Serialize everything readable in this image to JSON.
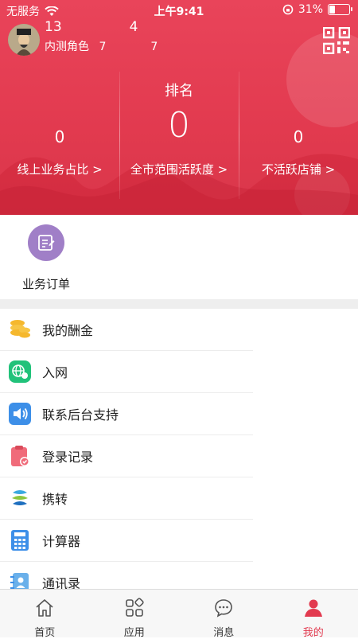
{
  "status_bar": {
    "carrier": "无服务",
    "time": "上午9:41",
    "battery": "31%"
  },
  "user": {
    "phone": "13     4",
    "role_label": "内测角色",
    "role_id": "7    7"
  },
  "stats": {
    "left": {
      "value": "0",
      "label": "线上业务占比 >"
    },
    "center": {
      "title": "排名",
      "value": "0",
      "label": "全市范围活跃度 >"
    },
    "right": {
      "value": "0",
      "label": "不活跃店铺 >"
    }
  },
  "quick": {
    "orders_label": "业务订单"
  },
  "menu": [
    {
      "label": "我的酬金",
      "icon": "coins-icon"
    },
    {
      "label": "入网",
      "icon": "network-globe-icon"
    },
    {
      "label": "联系后台支持",
      "icon": "speaker-icon"
    },
    {
      "label": "登录记录",
      "icon": "clipboard-check-icon"
    },
    {
      "label": "携转",
      "icon": "china-mobile-logo-icon"
    },
    {
      "label": "计算器",
      "icon": "calculator-icon"
    },
    {
      "label": "通讯录",
      "icon": "contacts-book-icon"
    }
  ],
  "tabs": [
    {
      "label": "首页",
      "icon": "home-icon"
    },
    {
      "label": "应用",
      "icon": "apps-icon"
    },
    {
      "label": "消息",
      "icon": "message-icon"
    },
    {
      "label": "我的",
      "icon": "profile-icon",
      "active": true
    }
  ],
  "colors": {
    "brand": "#e23a4f",
    "orders_icon_bg": "#a07fc7"
  }
}
